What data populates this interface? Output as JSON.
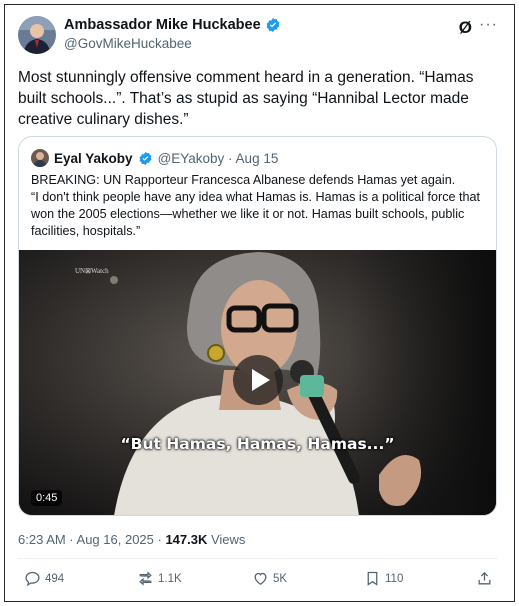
{
  "author": {
    "display_name": "Ambassador Mike Huckabee",
    "handle": "@GovMikeHuckabee",
    "verified_icon": "verified-badge-icon"
  },
  "header_icons": {
    "grok": "Ø",
    "more": "···"
  },
  "tweet": {
    "text": "Most stunningly offensive comment heard in a generation. “Hamas built schools...”. That’s as stupid as saying “Hannibal Lector made creative culinary dishes.”"
  },
  "quoted": {
    "display_name": "Eyal Yakoby",
    "handle_date": "@EYakoby · Aug 15",
    "line1": "BREAKING: UN Rapporteur Francesca Albanese defends Hamas yet again.",
    "line2": "“I don't think people have any idea what Hamas is. Hamas is a political force that won the 2005 elections—whether we like it or not. Hamas built schools, public facilities, hospitals.”",
    "video": {
      "watermark": "UN⊠Watch",
      "caption": "“But Hamas, Hamas, Hamas...”",
      "duration": "0:45"
    }
  },
  "meta": {
    "timestamp": "6:23 AM · Aug 16, 2025 · ",
    "views_count": "147.3K",
    "views_label": " Views"
  },
  "actions": {
    "replies": "494",
    "reposts": "1.1K",
    "likes": "5K",
    "bookmarks": "110"
  },
  "colors": {
    "verified_blue": "#1d9bf0",
    "text": "#0f1419",
    "secondary": "#536471",
    "border": "#cfd9de"
  }
}
